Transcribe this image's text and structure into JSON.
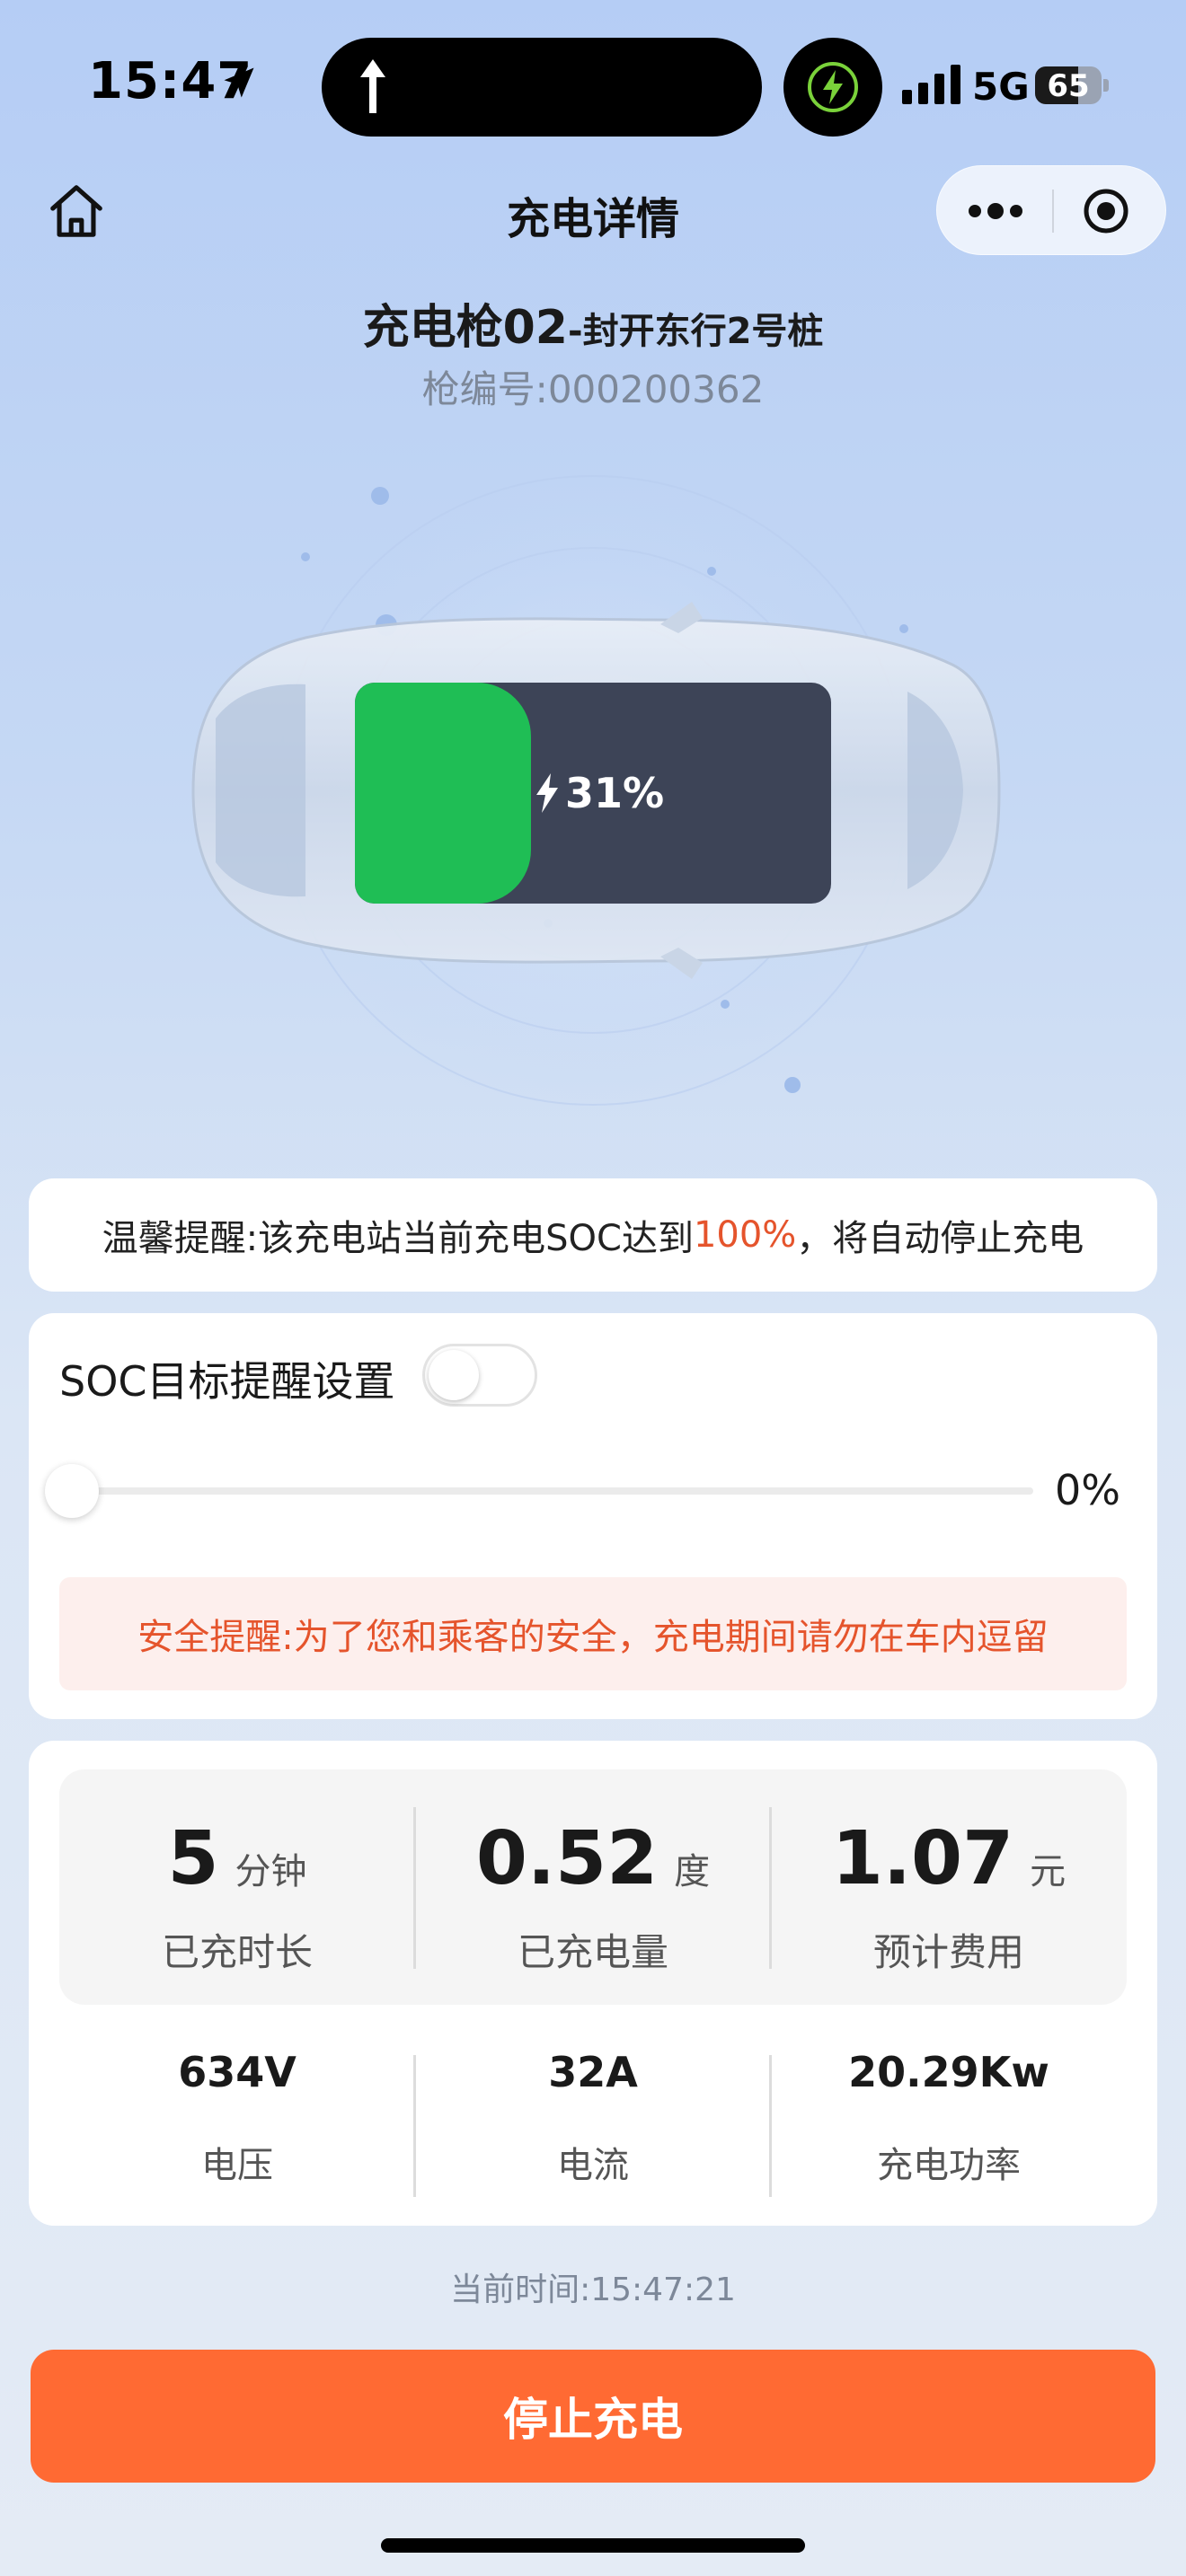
{
  "status_bar": {
    "time": "15:47",
    "network": "5G",
    "battery": "65",
    "battery_level": 0.65
  },
  "nav": {
    "title": "充电详情"
  },
  "gun": {
    "name": "充电枪02",
    "station": "-封开东行2号桩",
    "number": "枪编号:000200362"
  },
  "battery": {
    "percent_text": "31%",
    "percent": 0.31
  },
  "notice": {
    "prefix": "温馨提醒:该充电站当前充电SOC达到",
    "highlight": "100%",
    "suffix": "，将自动停止充电"
  },
  "soc": {
    "title": "SOC目标提醒设置",
    "toggle_on": false,
    "slider_value": "0%",
    "slider_level": 0.0,
    "safety_text": "安全提醒:为了您和乘客的安全，充电期间请勿在车内逗留"
  },
  "stats": {
    "duration": {
      "value": "5",
      "unit": "分钟",
      "label": "已充时长"
    },
    "energy": {
      "value": "0.52",
      "unit": "度",
      "label": "已充电量"
    },
    "cost": {
      "value": "1.07",
      "unit": "元",
      "label": "预计费用"
    },
    "voltage": {
      "value": "634V",
      "label": "电压"
    },
    "current": {
      "value": "32A",
      "label": "电流"
    },
    "power": {
      "value": "20.29Kw",
      "label": "充电功率"
    }
  },
  "current_time": "当前时间:15:47:21",
  "stop_button": "停止充电",
  "colors": {
    "accent": "#ff6a33",
    "battery_green": "#1fbe55",
    "highlight_red": "#e5542c"
  }
}
